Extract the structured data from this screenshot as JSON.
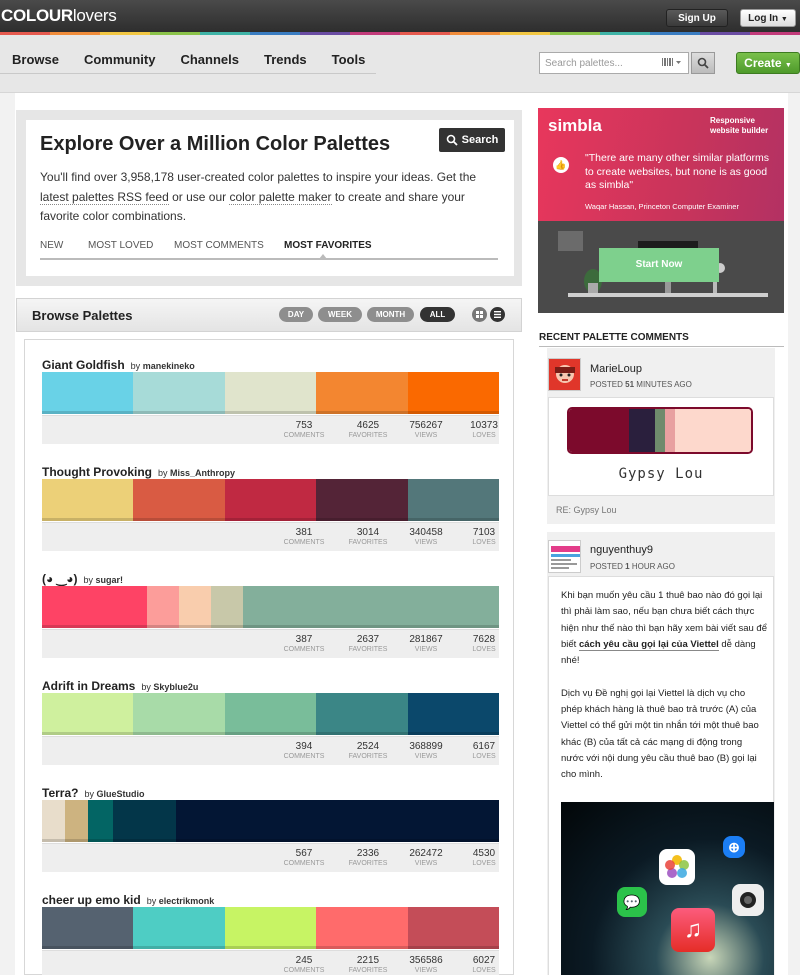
{
  "header": {
    "logo_bold": "COLOUR",
    "logo_rest": "lovers",
    "signup": "Sign Up",
    "login": "Log In",
    "login_caret": "▼",
    "rainbow": [
      "#e65a4f",
      "#f08c3a",
      "#f2c743",
      "#8bc34a",
      "#3fb3a6",
      "#3a7dc2",
      "#6a4ca3",
      "#c23b7a",
      "#e65a4f",
      "#f08c3a",
      "#f2c743",
      "#8bc34a",
      "#3fb3a6",
      "#3a7dc2",
      "#6a4ca3",
      "#c23b7a"
    ]
  },
  "nav": {
    "items": [
      "Browse",
      "Community",
      "Channels",
      "Trends",
      "Tools"
    ]
  },
  "search": {
    "placeholder": "Search palettes..."
  },
  "create_label": "Create",
  "create_caret": "▼",
  "explore": {
    "title": "Explore Over a Million Color Palettes",
    "search_btn": "Search",
    "desc_1": "You'll find over 3,958,178 user-created color palettes to inspire your ideas. Get the ",
    "link_rss": "latest palettes RSS feed",
    "desc_2": " or use our ",
    "link_maker": "color palette maker",
    "desc_3": " to create and share your favorite color combinations.",
    "tabs": [
      "NEW",
      "MOST LOVED",
      "MOST COMMENTS",
      "MOST FAVORITES"
    ],
    "active_tab": 3
  },
  "browse": {
    "title": "Browse Palettes",
    "filters": [
      "DAY",
      "WEEK",
      "MONTH",
      "ALL"
    ],
    "active_filter": 3,
    "stat_labels": [
      "COMMENTS",
      "FAVORITES",
      "VIEWS",
      "LOVES"
    ],
    "palettes": [
      {
        "title": "Giant Goldfish",
        "by": "by",
        "author": "manekineko",
        "colors": [
          {
            "hex": "#69D2E7",
            "w": 1
          },
          {
            "hex": "#A7DBD8",
            "w": 1
          },
          {
            "hex": "#E0E4CC",
            "w": 1
          },
          {
            "hex": "#F38630",
            "w": 1
          },
          {
            "hex": "#FA6900",
            "w": 1
          }
        ],
        "stats": [
          "753",
          "4625",
          "756267",
          "10373"
        ]
      },
      {
        "title": "Thought Provoking",
        "by": "by",
        "author": "Miss_Anthropy",
        "colors": [
          {
            "hex": "#ECD078",
            "w": 1
          },
          {
            "hex": "#D95B43",
            "w": 1
          },
          {
            "hex": "#C02942",
            "w": 1
          },
          {
            "hex": "#542437",
            "w": 1
          },
          {
            "hex": "#53777A",
            "w": 1
          }
        ],
        "stats": [
          "381",
          "3014",
          "340458",
          "7103"
        ]
      },
      {
        "title": "(◕ ‿◕)",
        "by": "by",
        "author": "sugar!",
        "colors": [
          {
            "hex": "#FE4365",
            "w": 1.15
          },
          {
            "hex": "#FC9D9A",
            "w": 0.35
          },
          {
            "hex": "#F9CDAD",
            "w": 0.35
          },
          {
            "hex": "#C8C8A9",
            "w": 0.35
          },
          {
            "hex": "#83AF9B",
            "w": 2.8
          }
        ],
        "stats": [
          "387",
          "2637",
          "281867",
          "7628"
        ]
      },
      {
        "title": "Adrift in Dreams",
        "by": "by",
        "author": "Skyblue2u",
        "colors": [
          {
            "hex": "#CFF09E",
            "w": 1
          },
          {
            "hex": "#A8DBA8",
            "w": 1
          },
          {
            "hex": "#79BD9A",
            "w": 1
          },
          {
            "hex": "#3B8686",
            "w": 1
          },
          {
            "hex": "#0B486B",
            "w": 1
          }
        ],
        "stats": [
          "394",
          "2524",
          "368899",
          "6167"
        ]
      },
      {
        "title": "Terra?",
        "by": "by",
        "author": "GlueStudio",
        "colors": [
          {
            "hex": "#E8DDCB",
            "w": 0.25
          },
          {
            "hex": "#CDB380",
            "w": 0.25
          },
          {
            "hex": "#036564",
            "w": 0.28
          },
          {
            "hex": "#033649",
            "w": 0.69
          },
          {
            "hex": "#031634",
            "w": 3.53
          }
        ],
        "stats": [
          "567",
          "2336",
          "262472",
          "4530"
        ]
      },
      {
        "title": "cheer up emo kid",
        "by": "by",
        "author": "electrikmonk",
        "colors": [
          {
            "hex": "#556270",
            "w": 1
          },
          {
            "hex": "#4ECDC4",
            "w": 1
          },
          {
            "hex": "#C7F464",
            "w": 1
          },
          {
            "hex": "#FF6B6B",
            "w": 1
          },
          {
            "hex": "#C44D58",
            "w": 1
          }
        ],
        "stats": [
          "245",
          "2215",
          "356586",
          "6027"
        ]
      }
    ]
  },
  "ad": {
    "logo": "simbla",
    "responsive": "Responsive\nwebsite builder",
    "quote": "\"There are many other similar platforms to create websites, but none is as good as simbla\"",
    "author": "Waqar Hassan, Princeton Computer Examiner",
    "cta": "Start Now"
  },
  "recent": {
    "heading": "RECENT PALETTE COMMENTS",
    "c1": {
      "name": "MarieLoup",
      "posted": "POSTED",
      "num": "51",
      "ago": "MINUTES AGO",
      "palette": [
        "#7C0A2C",
        "#2A1F3D",
        "#6E8A6C",
        "#E8A0A0",
        "#FDD8CC"
      ],
      "palette_title": "Gypsy Lou",
      "re": "RE: Gypsy Lou"
    },
    "c2": {
      "name": "nguyenthuy9",
      "posted": "POSTED",
      "num": "1",
      "ago": "HOUR AGO",
      "p1a": "Khi bạn muốn yêu cầu 1 thuê bao nào đó gọi lại thì phải làm sao, nếu bạn chưa biết cách thực hiện như thế nào thì bạn hãy xem bài viết sau để biết ",
      "p1link": "cách yêu cầu gọi lại của Viettel",
      "p1b": " dễ dàng nhé!",
      "p2": "Dịch vụ Đề nghị gọi lại Viettel là dịch vụ cho phép khách hàng là thuê bao trả trước (A) của Viettel có thể gửi một tin nhắn tới một thuê bao khác (B) của tất cả các mạng di động trong nước với nội dung yêu cầu thuê bao (B) gọi lại cho mình."
    }
  }
}
